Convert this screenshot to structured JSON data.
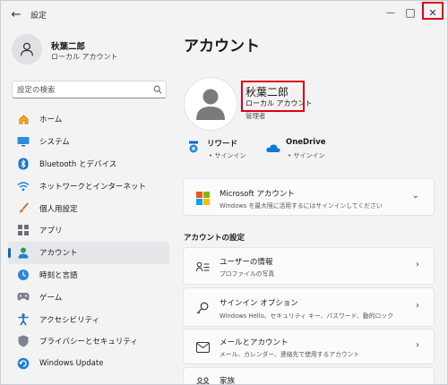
{
  "titlebar": {
    "back": "←",
    "app_title": "設定",
    "minimize": "—",
    "maximize": "□",
    "close": "✕"
  },
  "sidebar": {
    "user_name": "秋葉二郎",
    "account_type": "ローカル アカウント",
    "search_placeholder": "設定の検索",
    "items": [
      {
        "label": "ホーム",
        "icon": "home-icon"
      },
      {
        "label": "システム",
        "icon": "monitor-icon"
      },
      {
        "label": "Bluetooth とデバイス",
        "icon": "bluetooth-icon"
      },
      {
        "label": "ネットワークとインターネット",
        "icon": "wifi-icon"
      },
      {
        "label": "個人用設定",
        "icon": "brush-icon"
      },
      {
        "label": "アプリ",
        "icon": "apps-icon"
      },
      {
        "label": "アカウント",
        "icon": "account-icon",
        "active": true
      },
      {
        "label": "時刻と言語",
        "icon": "globe-clock-icon"
      },
      {
        "label": "ゲーム",
        "icon": "gamepad-icon"
      },
      {
        "label": "アクセシビリティ",
        "icon": "accessibility-icon"
      },
      {
        "label": "プライバシーとセキュリティ",
        "icon": "shield-icon"
      },
      {
        "label": "Windows Update",
        "icon": "update-icon"
      }
    ]
  },
  "main": {
    "title": "アカウント",
    "user_name": "秋葉二郎",
    "account_type": "ローカル アカウント",
    "role": "管理者",
    "services": [
      {
        "name": "リワード",
        "status": "• サインイン",
        "icon": "rewards-icon"
      },
      {
        "name": "OneDrive",
        "status": "• サインイン",
        "icon": "onedrive-icon"
      }
    ],
    "ms_account": {
      "title": "Microsoft アカウント",
      "desc": "Windows を最大限に活用するにはサインインしてください"
    },
    "section_title": "アカウントの設定",
    "settings": [
      {
        "title": "ユーザーの情報",
        "desc": "プロファイルの写真",
        "icon": "user-info-icon"
      },
      {
        "title": "サインイン オプション",
        "desc": "Windows Hello、セキュリティ キー、パスワード、動的ロック",
        "icon": "key-icon"
      },
      {
        "title": "メールとアカウント",
        "desc": "メール、カレンダー、連絡先で使用するアカウント",
        "icon": "mail-icon"
      },
      {
        "title": "家族",
        "desc": "",
        "icon": "family-icon"
      }
    ]
  },
  "colors": {
    "accent": "#0067c0",
    "highlight_box": "#e0001b",
    "window_bg": "#f3f3f3",
    "card_bg": "#fbfbfb"
  }
}
